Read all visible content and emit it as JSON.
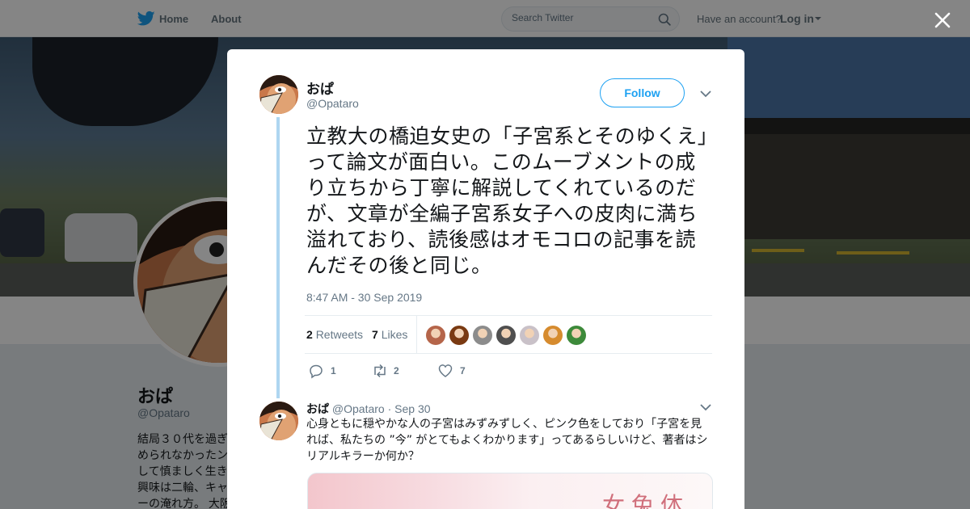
{
  "colors": {
    "brand": "#1da1f2",
    "text": "#14171a",
    "muted": "#657786"
  },
  "topbar": {
    "home_label": "Home",
    "about_label": "About",
    "search_placeholder": "Search Twitter",
    "have_account": "Have an account?",
    "login_label": "Log in"
  },
  "profile": {
    "name": "おぱ",
    "handle": "@Opataro",
    "bio": "結局３０代を過ぎ\nめられなかったン\nして慎ましく生き\n興味は二輪、キャ\nーの淹れ方。 大阪"
  },
  "tweet": {
    "name": "おぱ",
    "handle": "@Opataro",
    "follow_label": "Follow",
    "text": "立教大の橋迫女史の「子宮系とそのゆくえ」って論文が面白い。このムーブメントの成り立ちから丁寧に解説してくれているのだが、文章が全編子宮系女子への皮肉に満ち溢れており、読後感はオモコロの記事を読んだその後と同じ。",
    "timestamp": "8:47 AM - 30 Sep 2019",
    "retweets_count": "2",
    "retweets_label": "Retweets",
    "likes_count": "7",
    "likes_label": "Likes",
    "likers": [
      {
        "icon": "liker-avatar",
        "color": "#b5654a"
      },
      {
        "icon": "liker-avatar",
        "color": "#7a3a12"
      },
      {
        "icon": "liker-avatar",
        "color": "#8c8c8c"
      },
      {
        "icon": "liker-avatar",
        "color": "#4f4f4f"
      },
      {
        "icon": "liker-avatar",
        "color": "#c9c1c8"
      },
      {
        "icon": "liker-avatar",
        "color": "#d68b2e"
      },
      {
        "icon": "liker-avatar",
        "color": "#3d8a3a"
      }
    ],
    "reply_count": "1",
    "retweet_action_count": "2",
    "like_action_count": "7"
  },
  "reply": {
    "name": "おぱ",
    "handle": "@Opataro",
    "dot": "·",
    "date": "Sep 30",
    "text": "心身ともに穏やかな人の子宮はみずみずしく、ピンク色をしており「子宮を見れば、私たちの ”今” がとてもよくわかります」ってあるらしいけど、著者はシリアルキラーか何か？",
    "media_text": "女兔体"
  }
}
